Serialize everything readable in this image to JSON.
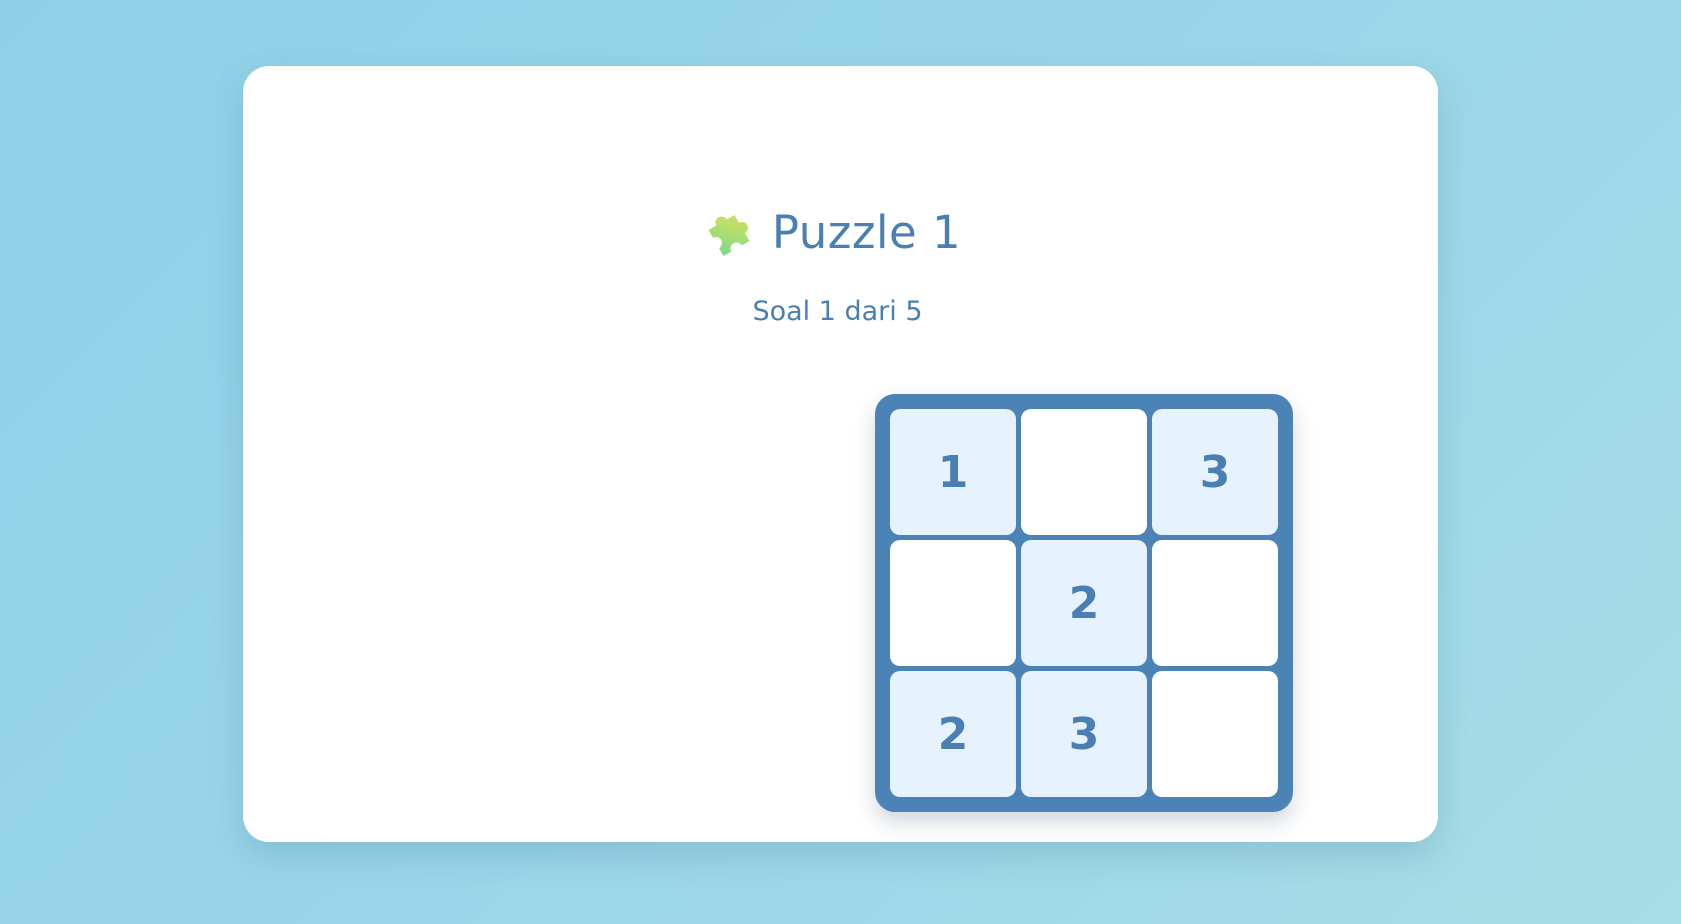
{
  "puzzle": {
    "icon": "puzzle-piece-icon",
    "title": "Puzzle 1",
    "subtitle": "Soal 1 dari 5"
  },
  "board": {
    "size": 3,
    "cells": [
      {
        "value": "1",
        "given": true
      },
      {
        "value": "",
        "given": false
      },
      {
        "value": "3",
        "given": true
      },
      {
        "value": "",
        "given": false
      },
      {
        "value": "2",
        "given": true
      },
      {
        "value": "",
        "given": false
      },
      {
        "value": "2",
        "given": true
      },
      {
        "value": "3",
        "given": true
      },
      {
        "value": "",
        "given": false
      }
    ]
  },
  "colors": {
    "accent": "#4a7fb3",
    "board_frame": "#4b83b6",
    "given_cell": "#e6f2fd",
    "empty_cell": "#ffffff",
    "background": "#8fd0e8"
  }
}
